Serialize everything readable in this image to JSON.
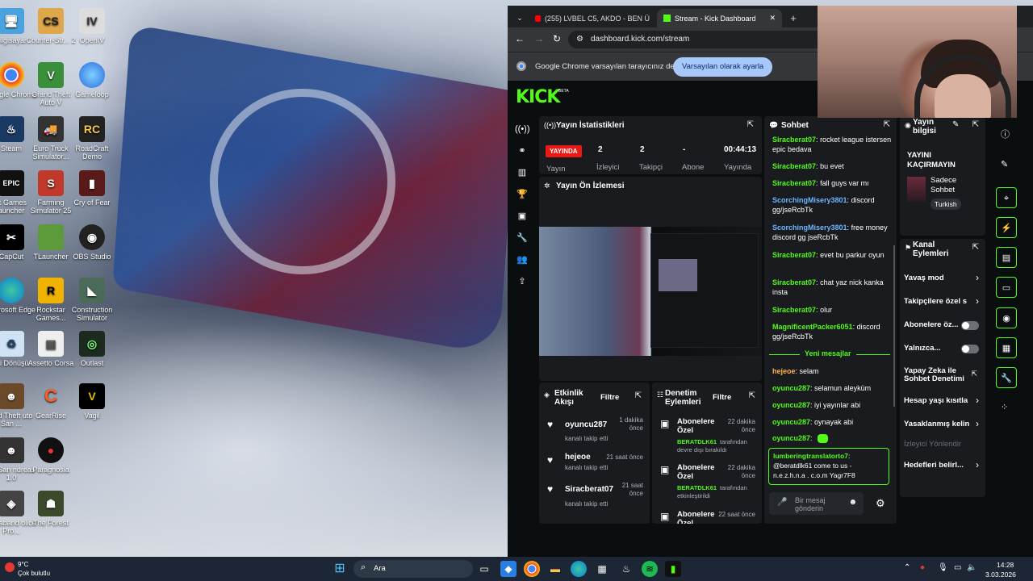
{
  "desktop": {
    "icons": [
      {
        "label": "bilgisayar"
      },
      {
        "label": "Counter-Str... 2"
      },
      {
        "label": "OpenIV"
      },
      {
        "label": "Google Chrome"
      },
      {
        "label": "Grand Theft Auto V"
      },
      {
        "label": "Gameloop"
      },
      {
        "label": "Steam"
      },
      {
        "label": "Euro Truck Simulator..."
      },
      {
        "label": "RoadCraft Demo"
      },
      {
        "label": "ic Games auncher"
      },
      {
        "label": "Farming Simulator 25"
      },
      {
        "label": "Cry of Fear"
      },
      {
        "label": "CapCut"
      },
      {
        "label": "TLauncher"
      },
      {
        "label": "OBS Studio"
      },
      {
        "label": "Microsoft Edge"
      },
      {
        "label": "Rockstar Games..."
      },
      {
        "label": "Construction Simulator"
      },
      {
        "label": "Geri Dönüşü..."
      },
      {
        "label": "Assetto Corsa"
      },
      {
        "label": "Outlast"
      },
      {
        "label": "and Theft uto San ..."
      },
      {
        "label": "GearRise"
      },
      {
        "label": "Vagil"
      },
      {
        "label": "TA San ndreas 1.0"
      },
      {
        "label": "Paragnosia"
      },
      {
        "label": "ontraband olice Pro..."
      },
      {
        "label": "The Forest"
      }
    ]
  },
  "browser": {
    "tabs": [
      {
        "label": "(255) LVBEL C5, AKDO - BEN Ü"
      },
      {
        "label": "Stream - Kick Dashboard"
      }
    ],
    "url": "dashboard.kick.com/stream",
    "infobar": {
      "message": "Google Chrome varsayılan tarayıcınız değil",
      "button": "Varsayılan olarak ayarla"
    }
  },
  "kick": {
    "logo": "KICK",
    "logo_badge": "BETA",
    "stats": {
      "title": "Yayın İstatistikleri",
      "live_badge": "YAYINDA",
      "viewers": "2",
      "followers": "2",
      "subs": "-",
      "uptime": "00:44:13",
      "labels": [
        "Yayın",
        "İzleyici",
        "Takipçi",
        "Abone",
        "Yayında"
      ]
    },
    "preview": {
      "title": "Yayın Ön İzlemesi"
    },
    "activity": {
      "title": "Etkinlik Akışı",
      "filter": "Filtre",
      "items": [
        {
          "user": "oyuncu287",
          "desc": "kanalı takip etti",
          "time": "1 dakika önce"
        },
        {
          "user": "hejeoe",
          "desc": "kanalı takip etti",
          "time": "21 saat önce"
        },
        {
          "user": "Siracberat07",
          "desc": "kanalı takip etti",
          "time": "21 saat önce"
        }
      ]
    },
    "moderation": {
      "title": "Denetim Eylemleri",
      "filter": "Filtre",
      "items": [
        {
          "title": "Abonelere Özel",
          "user": "BERATDLK61",
          "desc1": "tarafından",
          "desc2": "devre dışı bırakıldı",
          "time": "22 dakika önce"
        },
        {
          "title": "Abonelere Özel",
          "user": "BERATDLK61",
          "desc1": "tarafından",
          "desc2": "etkinleştirildi",
          "time": "22 dakika önce"
        },
        {
          "title": "Abonelere Özel",
          "user": "",
          "desc1": "",
          "desc2": "",
          "time": "22 saat önce"
        }
      ]
    },
    "chat": {
      "title": "Sohbet",
      "messages": [
        {
          "user": "Siracberat07",
          "text": "rocket league istersen epic bedava",
          "color": "u1"
        },
        {
          "user": "Siracberat07",
          "text": "bu evet",
          "color": "u1"
        },
        {
          "user": "Siracberat07",
          "text": "fall guys var mı",
          "color": "u1"
        },
        {
          "user": "ScorchingMisery3801",
          "text": "discord gg/jseRcbTk",
          "color": "u2"
        },
        {
          "user": "ScorchingMisery3801",
          "text": "free money discord gg jseRcbTk",
          "color": "u2"
        },
        {
          "user": "Siracberat07",
          "text": "evet bu parkur oyun",
          "color": "u1"
        },
        {
          "user": "Siracberat07",
          "text": "chat yaz nick kanka insta",
          "color": "u1"
        },
        {
          "user": "Siracberat07",
          "text": "olur",
          "color": "u1"
        },
        {
          "user": "MagnificentPacker6051",
          "text": "discord gg/jseRcbTk",
          "color": "u1"
        }
      ],
      "new_messages_label": "Yeni mesajlar",
      "new_messages": [
        {
          "user": "hejeoe",
          "text": "selam",
          "color": "u3"
        },
        {
          "user": "oyuncu287",
          "text": "selamun aleyküm",
          "color": "u1"
        },
        {
          "user": "oyuncu287",
          "text": "iyi yayınlar abi",
          "color": "u1"
        },
        {
          "user": "oyuncu287",
          "text": "oynayak abi",
          "color": "u1"
        },
        {
          "user": "oyuncu287",
          "text": "",
          "color": "u1"
        }
      ],
      "highlight": {
        "user": "lumberingtranslatorto7",
        "text": "@beratdlk61 come to us - n.e.z.h.n.a . c.o.m Yagr7F8"
      },
      "input_placeholder": "Bir mesaj gönderin"
    },
    "stream_info": {
      "title": "Yayın bilgisi",
      "headline": "YAYINI KAÇIRMAYIN",
      "category": "Sadece Sohbet",
      "tag": "Turkish"
    },
    "channel_actions": {
      "title": "Kanal Eylemleri",
      "rows": [
        {
          "label": "Yavaş mod",
          "type": "chevron"
        },
        {
          "label": "Takipçilere özel s",
          "type": "chevron"
        },
        {
          "label": "Abonelere öz...",
          "type": "toggle"
        },
        {
          "label": "Yalnızca...",
          "type": "toggle"
        },
        {
          "label": "Yapay Zeka ile Sohbet Denetimi",
          "type": "external"
        },
        {
          "label": "Hesap yaşı kısıtla",
          "type": "chevron"
        },
        {
          "label": "Yasaklanmış kelin",
          "type": "chevron"
        },
        {
          "label": "İzleyici Yönlendir",
          "type": "disabled"
        },
        {
          "label": "Hedefleri belirl...",
          "type": "chevron"
        }
      ]
    }
  },
  "taskbar": {
    "weather_temp": "9°C",
    "weather_desc": "Çok bulutlu",
    "search": "Ara",
    "time": "14:28",
    "date": "3.03.2026"
  },
  "colors": {
    "kick_green": "#53fc18",
    "live_red": "#e91916"
  }
}
